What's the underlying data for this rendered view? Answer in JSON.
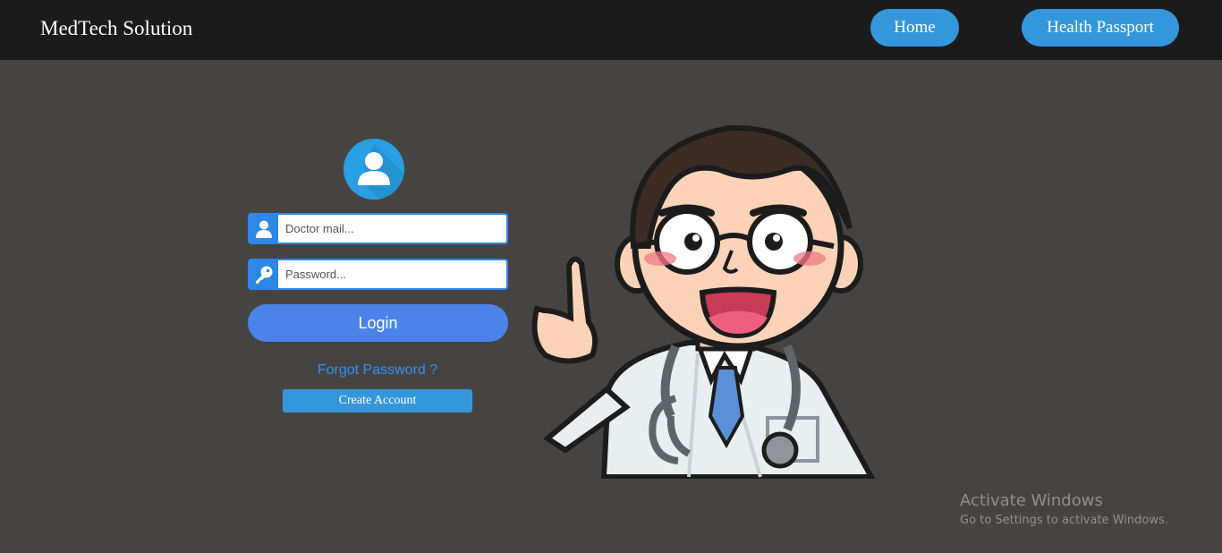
{
  "header": {
    "brand": "MedTech Solution",
    "nav": {
      "home": "Home",
      "health_passport": "Health Passport"
    }
  },
  "login": {
    "email_placeholder": "Doctor mail...",
    "password_placeholder": "Password...",
    "login_label": "Login",
    "forgot_label": "Forgot Password ?",
    "create_label": "Create Account"
  },
  "icons": {
    "avatar": "user-avatar-icon",
    "email": "user-icon",
    "password": "key-icon",
    "illustration": "doctor-illustration"
  },
  "watermark": {
    "title": "Activate Windows",
    "subtitle": "Go to Settings to activate Windows."
  },
  "colors": {
    "header_bg": "#1b1b1b",
    "page_bg": "#464443",
    "nav_button": "#3497dc",
    "field_accent": "#2d87e6",
    "login_button": "#4b83e8",
    "link": "#2f8df2"
  }
}
